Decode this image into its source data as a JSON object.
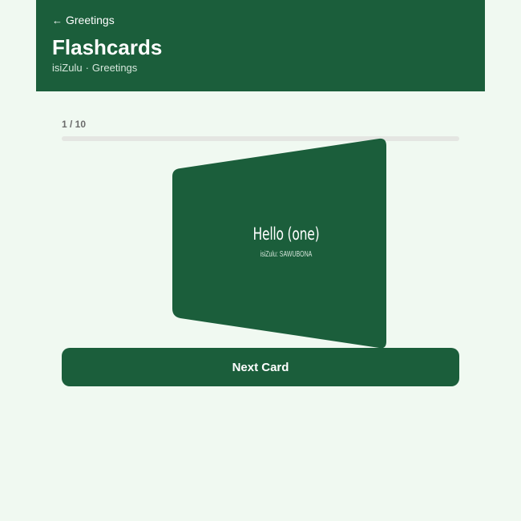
{
  "header": {
    "back_label": "Greetings",
    "title": "Flashcards",
    "language": "isiZulu",
    "category": "Greetings"
  },
  "progress": {
    "label": "1 / 10",
    "current": 1,
    "total": 10
  },
  "card": {
    "front": "Hello (one)",
    "hint_language": "isiZulu:",
    "hint_answer": "SAWUBONA"
  },
  "actions": {
    "next_label": "Next Card"
  },
  "colors": {
    "primary": "#1b5e3b",
    "background": "#f0f9f1",
    "track": "#e4e6e2"
  },
  "icons": {
    "back": "arrow-left-icon"
  }
}
